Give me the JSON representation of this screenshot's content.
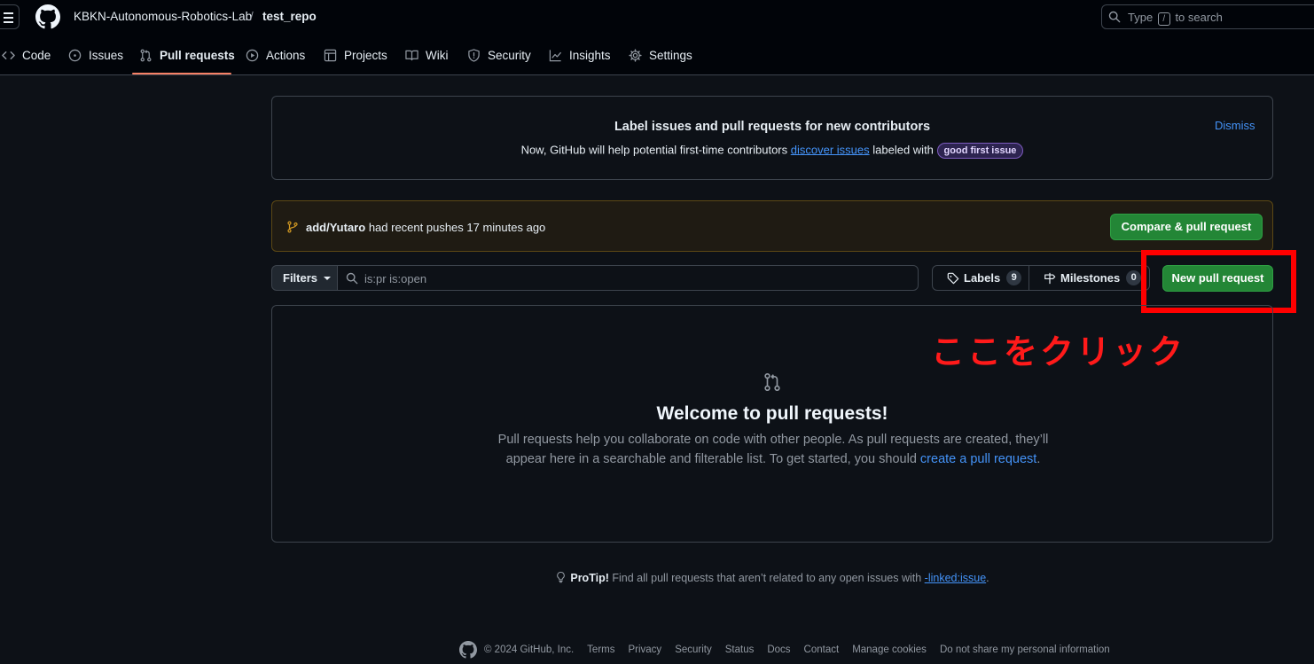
{
  "header": {
    "owner": "KBKN-Autonomous-Robotics-Lab",
    "separator": "/",
    "repo": "test_repo",
    "search_prefix": "Type",
    "search_key": "/",
    "search_suffix": "to search"
  },
  "tabs": [
    {
      "label": "Code",
      "icon": "code-icon"
    },
    {
      "label": "Issues",
      "icon": "issue-opened-icon"
    },
    {
      "label": "Pull requests",
      "icon": "git-pull-request-icon",
      "active": true
    },
    {
      "label": "Actions",
      "icon": "play-icon"
    },
    {
      "label": "Projects",
      "icon": "table-icon"
    },
    {
      "label": "Wiki",
      "icon": "book-icon"
    },
    {
      "label": "Security",
      "icon": "shield-icon"
    },
    {
      "label": "Insights",
      "icon": "graph-icon"
    },
    {
      "label": "Settings",
      "icon": "gear-icon"
    }
  ],
  "banner": {
    "title": "Label issues and pull requests for new contributors",
    "text_before": "Now, GitHub will help potential first-time contributors",
    "link": "discover issues",
    "text_after": "labeled with",
    "label": "good first issue",
    "dismiss": "Dismiss",
    "label_color": "#7d5bbf"
  },
  "push": {
    "branch": "add/Yutaro",
    "text": "had recent pushes 17 minutes ago",
    "button": "Compare & pull request"
  },
  "filter_bar": {
    "filters": "Filters",
    "query": "is:pr is:open",
    "labels": "Labels",
    "labels_count": "9",
    "milestones": "Milestones",
    "milestones_count": "0",
    "new_pr": "New pull request"
  },
  "annotation": {
    "text": "ここをクリック",
    "color": "#ff0000"
  },
  "blank_slate": {
    "title": "Welcome to pull requests!",
    "text": "Pull requests help you collaborate on code with other people. As pull requests are created, they’ll appear here in a searchable and filterable list. To get started, you should",
    "link": "create a pull request",
    "end": "."
  },
  "protip": {
    "title": "ProTip!",
    "text": "Find all pull requests that aren’t related to any open issues with",
    "link": "-linked:issue",
    "end": "."
  },
  "footer": {
    "copyright": "© 2024 GitHub, Inc.",
    "links": [
      "Terms",
      "Privacy",
      "Security",
      "Status",
      "Docs",
      "Contact",
      "Manage cookies",
      "Do not share my personal information"
    ]
  },
  "colors": {
    "accent_green": "#238636",
    "link_blue": "#4493f8",
    "tab_underline": "#f78166",
    "background": "#0d1117"
  }
}
